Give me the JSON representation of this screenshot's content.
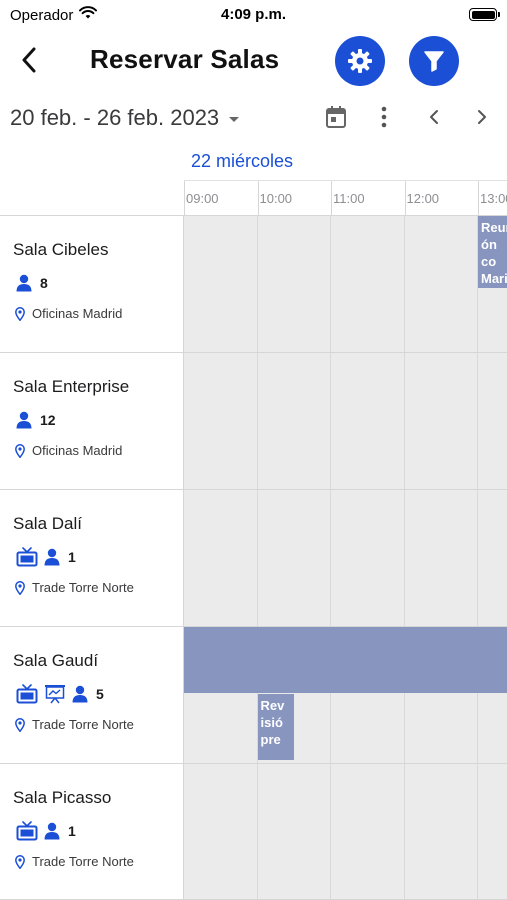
{
  "status_bar": {
    "carrier": "Operador",
    "time": "4:09 p.m."
  },
  "header": {
    "title": "Reservar Salas",
    "back_icon": "chevron-left-icon",
    "settings_icon": "gear-icon",
    "filter_icon": "funnel-icon",
    "accent_color": "#1a4fd6"
  },
  "toolbar": {
    "date_range": "20 feb. - 26 feb. 2023",
    "calendar_icon": "calendar-icon",
    "more_icon": "more-vertical-icon",
    "prev_icon": "chevron-left-icon",
    "next_icon": "chevron-right-icon"
  },
  "day_label": "22 miércoles",
  "hours": [
    "09:00",
    "10:00",
    "11:00",
    "12:00",
    "13:00"
  ],
  "rooms": [
    {
      "name": "Sala Cibeles",
      "features": [
        "person-icon"
      ],
      "capacity": "8",
      "location": "Oficinas Madrid"
    },
    {
      "name": "Sala Enterprise",
      "features": [
        "person-icon"
      ],
      "capacity": "12",
      "location": "Oficinas Madrid"
    },
    {
      "name": "Sala Dalí",
      "features": [
        "tv-icon",
        "person-icon"
      ],
      "capacity": "1",
      "location": "Trade Torre Norte"
    },
    {
      "name": "Sala Gaudí",
      "features": [
        "tv-icon",
        "projector-icon",
        "person-icon"
      ],
      "capacity": "5",
      "location": "Trade Torre Norte"
    },
    {
      "name": "Sala Picasso",
      "features": [
        "tv-icon",
        "person-icon"
      ],
      "capacity": "1",
      "location": "Trade Torre Norte"
    }
  ],
  "events": [
    {
      "room": 0,
      "text": "Reunión con Mari",
      "lines": "Reuni\nón co\nMari",
      "start": "13:00",
      "end": "13:30",
      "color": "#8795bf"
    },
    {
      "room": 3,
      "text": "",
      "lines": "",
      "start": "09:00",
      "end": "13:30",
      "color": "#8795bf"
    },
    {
      "room": 3,
      "text": "Revisió pre",
      "lines": "Rev\nisió\npre",
      "start": "10:00",
      "end": "10:30",
      "color": "#8795bf"
    }
  ]
}
